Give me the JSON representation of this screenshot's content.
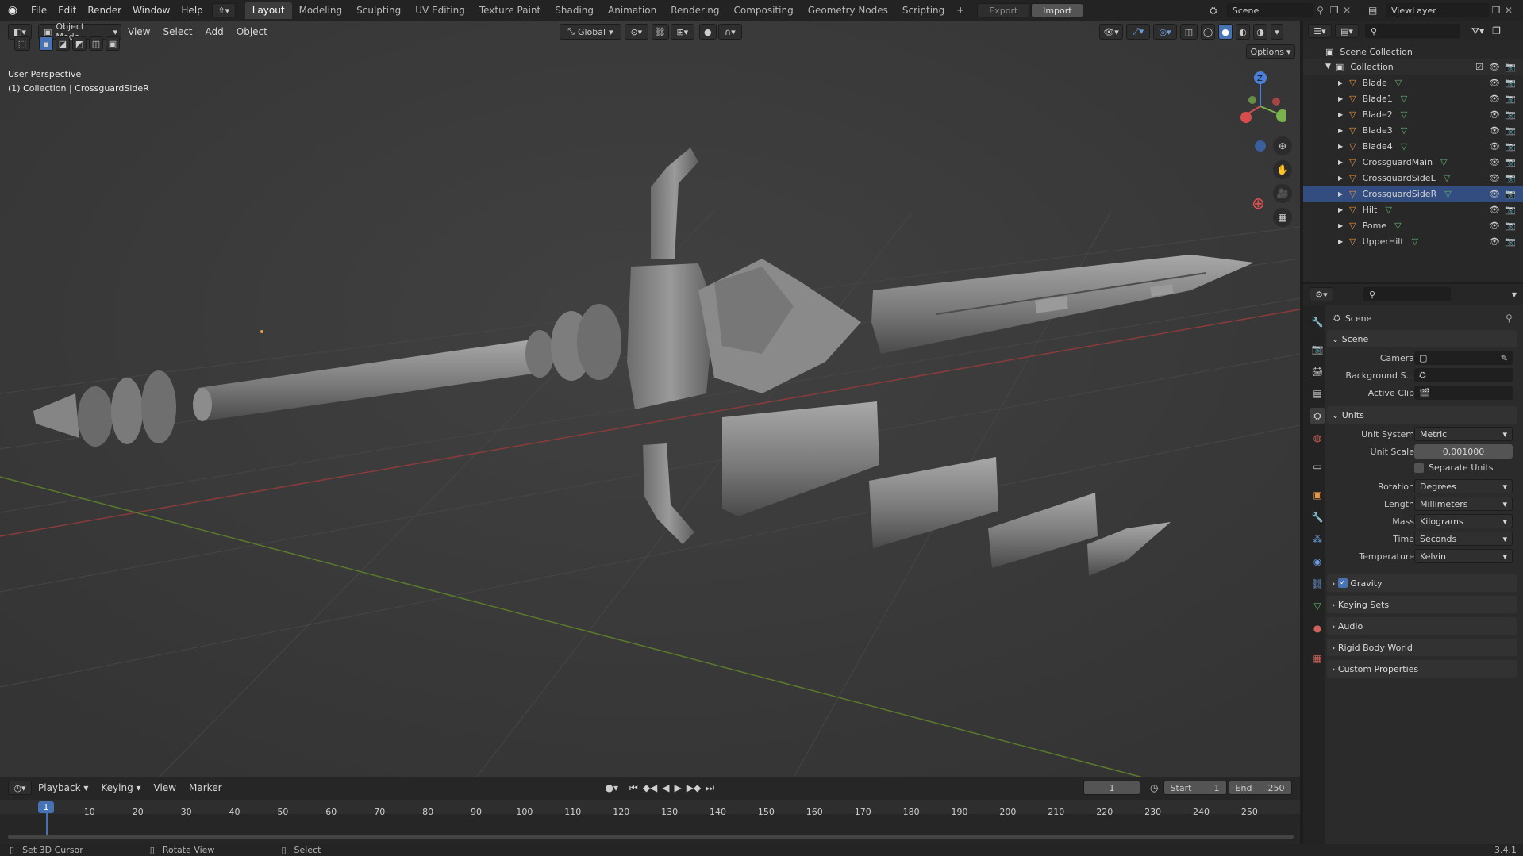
{
  "topbar": {
    "menus": [
      "File",
      "Edit",
      "Render",
      "Window",
      "Help"
    ],
    "workspaces": [
      "Layout",
      "Modeling",
      "Sculpting",
      "UV Editing",
      "Texture Paint",
      "Shading",
      "Animation",
      "Rendering",
      "Compositing",
      "Geometry Nodes",
      "Scripting"
    ],
    "active_workspace": "Layout",
    "export_label": "Export",
    "import_label": "Import",
    "scene_name": "Scene",
    "viewlayer_name": "ViewLayer"
  },
  "viewport": {
    "mode": "Object Mode",
    "menus": [
      "View",
      "Select",
      "Add",
      "Object"
    ],
    "transform_orientation": "Global",
    "options_label": "Options",
    "perspective_label": "User Perspective",
    "context_label": "(1) Collection | CrossguardSideR",
    "gizmo_axes": {
      "z": "Z",
      "y": "Y",
      "x": "X"
    }
  },
  "outliner": {
    "root": "Scene Collection",
    "collection": "Collection",
    "items": [
      "Blade",
      "Blade1",
      "Blade2",
      "Blade3",
      "Blade4",
      "CrossguardMain",
      "CrossguardSideL",
      "CrossguardSideR",
      "Hilt",
      "Pome",
      "UpperHilt"
    ]
  },
  "properties": {
    "context_title": "Scene",
    "scene_panel": "Scene",
    "camera_label": "Camera",
    "background_label": "Background S...",
    "active_clip_label": "Active Clip",
    "units_panel": "Units",
    "unit_system_label": "Unit System",
    "unit_system": "Metric",
    "unit_scale_label": "Unit Scale",
    "unit_scale": "0.001000",
    "separate_units": "Separate Units",
    "rotation_label": "Rotation",
    "rotation": "Degrees",
    "length_label": "Length",
    "length": "Millimeters",
    "mass_label": "Mass",
    "mass": "Kilograms",
    "time_label": "Time",
    "time": "Seconds",
    "temperature_label": "Temperature",
    "temperature": "Kelvin",
    "collapsed_panels": [
      "Gravity",
      "Keying Sets",
      "Audio",
      "Rigid Body World",
      "Custom Properties"
    ]
  },
  "timeline": {
    "menus": [
      "Playback",
      "Keying",
      "View",
      "Marker"
    ],
    "current_frame": "1",
    "start_label": "Start",
    "start": "1",
    "end_label": "End",
    "end": "250",
    "ticks": [
      "10",
      "20",
      "30",
      "40",
      "50",
      "60",
      "70",
      "80",
      "90",
      "100",
      "110",
      "120",
      "130",
      "140",
      "150",
      "160",
      "170",
      "180",
      "190",
      "200",
      "210",
      "220",
      "230",
      "240",
      "250"
    ]
  },
  "statusbar": {
    "hint1": "Set 3D Cursor",
    "hint2": "Rotate View",
    "hint3": "Select",
    "version": "3.4.1"
  },
  "colors": {
    "accent_blue": "#4772b3",
    "mesh_icon_orange": "#e2943f",
    "data_icon_green": "#5fb36a",
    "viewport_bg": "#3c3c3c"
  }
}
